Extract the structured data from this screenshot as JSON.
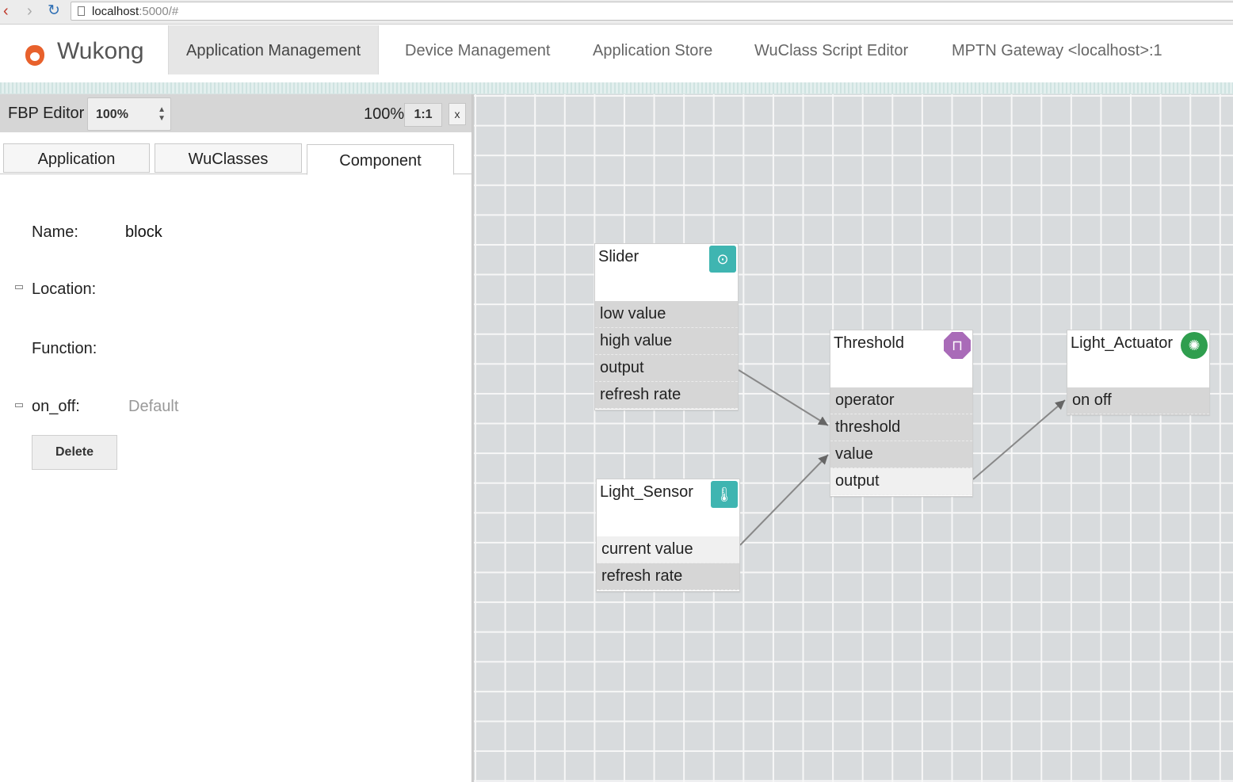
{
  "browser": {
    "url_host": "localhost",
    "url_rest": ":5000/#"
  },
  "navbar": {
    "brand": "Wukong",
    "items": [
      {
        "label": "Application Management",
        "active": true
      },
      {
        "label": "Device Management"
      },
      {
        "label": "Application Store"
      },
      {
        "label": "WuClass Script Editor"
      },
      {
        "label": "MPTN Gateway <localhost>:1"
      }
    ]
  },
  "editor": {
    "title": "FBP Editor",
    "zoom_select": "100%",
    "zoom_level": "100%",
    "one_to_one": "1:1",
    "close": "x"
  },
  "tabs": [
    {
      "label": "Application"
    },
    {
      "label": "WuClasses"
    },
    {
      "label": "Component",
      "active": true
    }
  ],
  "component_form": {
    "name_label": "Name:",
    "name_value": "block",
    "location_label": "Location:",
    "function_label": "Function:",
    "onoff_label": "on_off:",
    "onoff_placeholder": "Default",
    "delete_label": "Delete"
  },
  "components": {
    "slider": {
      "title": "Slider",
      "icon": "slider-icon",
      "color": "#3fb5b1",
      "props": [
        "low value",
        "high value",
        "output",
        "refresh rate"
      ]
    },
    "light_sensor": {
      "title": "Light_Sensor",
      "icon": "thermometer-icon",
      "color": "#3fb5b1",
      "props": [
        "current value",
        "refresh rate"
      ]
    },
    "threshold": {
      "title": "Threshold",
      "icon": "threshold-icon",
      "color": "#a96bb8",
      "props": [
        "operator",
        "threshold",
        "value",
        "output"
      ]
    },
    "light_actuator": {
      "title": "Light_Actuator",
      "icon": "lightbulb-icon",
      "color": "#2f9e4e",
      "props": [
        "on off"
      ]
    }
  },
  "links": [
    {
      "from": "Slider.output",
      "to": "Threshold.threshold"
    },
    {
      "from": "Light_Sensor.current value",
      "to": "Threshold.value"
    },
    {
      "from": "Threshold.output",
      "to": "Light_Actuator.on off"
    }
  ]
}
